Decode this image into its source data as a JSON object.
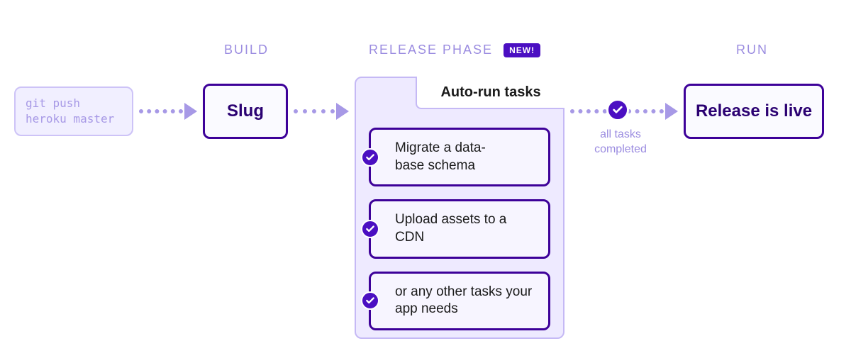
{
  "stages": {
    "build": "BUILD",
    "release": "RELEASE PHASE",
    "release_badge": "NEW!",
    "run": "RUN"
  },
  "git_push": "git push\nheroku master",
  "slug": "Slug",
  "release_live": "Release is live",
  "panel_title": "Auto-run tasks",
  "tasks": [
    "Migrate a data-\nbase schema",
    "Upload assets to a CDN",
    "or any other tasks your app needs"
  ],
  "all_tasks_label": "all tasks completed",
  "colors": {
    "primary": "#4b0fc2",
    "border_dark": "#3d0199",
    "border_light": "#c5b9f5",
    "text_light": "#9b8ce0",
    "panel_bg": "#eeeaff"
  }
}
